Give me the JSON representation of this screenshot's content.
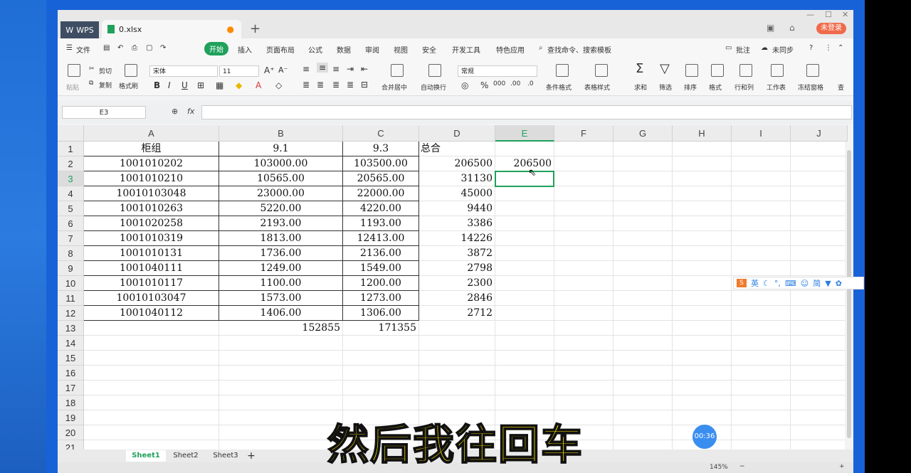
{
  "app": {
    "brand": "WPS",
    "file_tab": "0.xlsx",
    "login": "未登录"
  },
  "menu": [
    "文件",
    "开始",
    "插入",
    "页面布局",
    "公式",
    "数据",
    "审阅",
    "视图",
    "安全",
    "开发工具",
    "特色应用",
    "查找命令、搜索模板",
    "批注",
    "未同步"
  ],
  "ribbon": {
    "paste": "粘贴",
    "cut": "剪切",
    "copy": "复制",
    "format_painter": "格式刷",
    "font": "宋体",
    "size": "11",
    "number_format": "常规",
    "merge": "合并居中",
    "wrap": "自动换行",
    "cond_format": "条件格式",
    "table_style": "表格样式",
    "sum": "求和",
    "filter": "筛选",
    "sort": "排序",
    "format": "格式",
    "rowcol": "行和列",
    "sheet": "工作表",
    "freeze": "冻结窗格",
    "find": "查"
  },
  "namebox": "E3",
  "columns": [
    "A",
    "B",
    "C",
    "D",
    "E",
    "F",
    "G",
    "H",
    "I",
    "J"
  ],
  "rows": [
    "1",
    "2",
    "3",
    "4",
    "5",
    "6",
    "7",
    "8",
    "9",
    "10",
    "11",
    "12",
    "13",
    "14",
    "15",
    "16",
    "17",
    "18",
    "19",
    "20",
    "21"
  ],
  "grid": [
    [
      "柜组",
      "9.1",
      "9.3",
      "总合",
      ""
    ],
    [
      "1001010202",
      "103000.00",
      "103500.00",
      "206500",
      "206500"
    ],
    [
      "1001010210",
      "10565.00",
      "20565.00",
      "31130",
      ""
    ],
    [
      "10010103048",
      "23000.00",
      "22000.00",
      "45000",
      ""
    ],
    [
      "1001010263",
      "5220.00",
      "4220.00",
      "9440",
      ""
    ],
    [
      "1001020258",
      "2193.00",
      "1193.00",
      "3386",
      ""
    ],
    [
      "1001010319",
      "1813.00",
      "12413.00",
      "14226",
      ""
    ],
    [
      "1001010131",
      "1736.00",
      "2136.00",
      "3872",
      ""
    ],
    [
      "1001040111",
      "1249.00",
      "1549.00",
      "2798",
      ""
    ],
    [
      "1001010117",
      "1100.00",
      "1200.00",
      "2300",
      ""
    ],
    [
      "10010103047",
      "1573.00",
      "1273.00",
      "2846",
      ""
    ],
    [
      "1001040112",
      "1406.00",
      "1306.00",
      "2712",
      ""
    ],
    [
      "",
      "152855",
      "171355",
      "",
      ""
    ]
  ],
  "sheets": [
    "Sheet1",
    "Sheet2",
    "Sheet3"
  ],
  "status": {
    "zoom": "145%"
  },
  "ime": {
    "lang": "英",
    "simp": "简"
  },
  "timer": "00:36",
  "subtitle": "然后我往回车",
  "colors": {
    "accent": "#1fa15b",
    "titlebar": "#e8e8e8"
  }
}
